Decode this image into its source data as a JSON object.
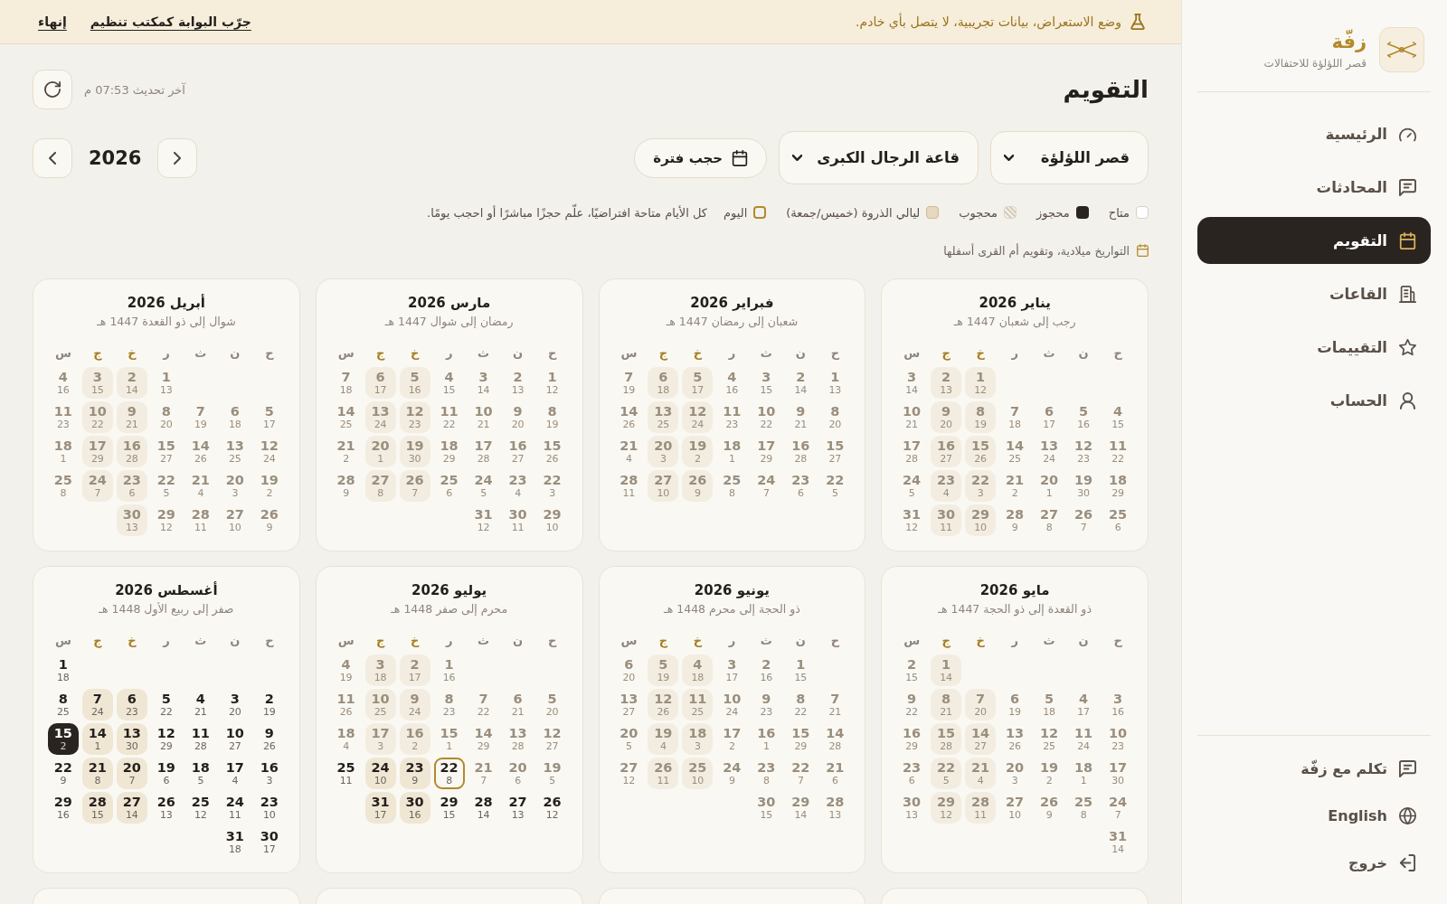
{
  "banner": {
    "message": "وضع الاستعراض، بيانات تجريبية، لا يتصل بأي خادم.",
    "links": [
      "جرّب البوابة كمكتب تنظيم",
      "إنهاء"
    ]
  },
  "header": {
    "title": "التقويم",
    "last_updated": "آخر تحديث 07:53 م"
  },
  "filters": [
    {
      "value": "قصر اللؤلؤة"
    },
    {
      "value": "قاعة الرجال الكبرى"
    }
  ],
  "block_button": "حجب فترة",
  "year": "2026",
  "legend": [
    {
      "kind": "available",
      "label": "متاح"
    },
    {
      "kind": "booked",
      "label": "محجوز"
    },
    {
      "kind": "blocked",
      "label": "محجوب"
    },
    {
      "kind": "peak",
      "label": "ليالي الذروة (خميس/جمعة)"
    },
    {
      "kind": "today",
      "label": "اليوم"
    }
  ],
  "legend_note": "كل الأيام متاحة افتراضيًا، علّم حجزًا مباشرًا أو احجب يومًا.",
  "calendar_note": "التواريخ ميلادية، وتقويم أم القرى أسفلها",
  "months": [
    {
      "title": "يناير 2026",
      "hijri_range": "رجب إلى شعبان 1447 هـ",
      "weekdays": [
        {
          "label": "ح",
          "peak": false
        },
        {
          "label": "ن",
          "peak": false
        },
        {
          "label": "ث",
          "peak": false
        },
        {
          "label": "ر",
          "peak": false
        },
        {
          "label": "خ",
          "peak": true
        },
        {
          "label": "ج",
          "peak": true
        },
        {
          "label": "س",
          "peak": false
        }
      ],
      "weeks": [
        [
          {
            "day": "1",
            "hijri": "12",
            "kind": "past"
          },
          {
            "day": "2",
            "hijri": "13",
            "kind": "past"
          },
          {
            "day": "3",
            "hijri": "14",
            "kind": "past"
          }
        ],
        [
          {
            "day": "4",
            "hijri": "15",
            "kind": "past"
          },
          {
            "day": "5",
            "hijri": "16",
            "kind": "past"
          },
          {
            "day": "6",
            "hijri": "17",
            "kind": "past"
          },
          {
            "day": "7",
            "hijri": "18",
            "kind": "past"
          },
          {
            "day": "8",
            "hijri": "19",
            "kind": "past"
          },
          {
            "day": "9",
            "hijri": "20",
            "kind": "past"
          },
          {
            "day": "10",
            "hijri": "21",
            "kind": "past"
          }
        ],
        [
          {
            "day": "11",
            "hijri": "22",
            "kind": "past"
          },
          {
            "day": "12",
            "hijri": "23",
            "kind": "past"
          },
          {
            "day": "13",
            "hijri": "24",
            "kind": "past"
          },
          {
            "day": "14",
            "hijri": "25",
            "kind": "past"
          },
          {
            "day": "15",
            "hijri": "26",
            "kind": "past"
          },
          {
            "day": "16",
            "hijri": "27",
            "kind": "past"
          },
          {
            "day": "17",
            "hijri": "28",
            "kind": "past"
          }
        ],
        [
          {
            "day": "18",
            "hijri": "29",
            "kind": "past"
          },
          {
            "day": "19",
            "hijri": "30",
            "kind": "past"
          },
          {
            "day": "20",
            "hijri": "1",
            "kind": "past"
          },
          {
            "day": "21",
            "hijri": "2",
            "kind": "past"
          },
          {
            "day": "22",
            "hijri": "3",
            "kind": "past"
          },
          {
            "day": "23",
            "hijri": "4",
            "kind": "past"
          },
          {
            "day": "24",
            "hijri": "5",
            "kind": "past"
          }
        ],
        [
          {
            "day": "25",
            "hijri": "6",
            "kind": "past"
          },
          {
            "day": "26",
            "hijri": "7",
            "kind": "past"
          },
          {
            "day": "27",
            "hijri": "8",
            "kind": "past"
          },
          {
            "day": "28",
            "hijri": "9",
            "kind": "past"
          },
          {
            "day": "29",
            "hijri": "10",
            "kind": "past"
          },
          {
            "day": "30",
            "hijri": "11",
            "kind": "past"
          },
          {
            "day": "31",
            "hijri": "12",
            "kind": "past"
          }
        ]
      ]
    },
    {
      "title": "فبراير 2026",
      "hijri_range": "شعبان إلى رمضان 1447 هـ",
      "weekdays": [
        {
          "label": "ح",
          "peak": false
        },
        {
          "label": "ن",
          "peak": false
        },
        {
          "label": "ث",
          "peak": false
        },
        {
          "label": "ر",
          "peak": false
        },
        {
          "label": "خ",
          "peak": true
        },
        {
          "label": "ج",
          "peak": true
        },
        {
          "label": "س",
          "peak": false
        }
      ],
      "weeks": [
        [
          {
            "day": "1",
            "hijri": "13",
            "kind": "past"
          },
          {
            "day": "2",
            "hijri": "14",
            "kind": "past"
          },
          {
            "day": "3",
            "hijri": "15",
            "kind": "past"
          },
          {
            "day": "4",
            "hijri": "16",
            "kind": "past"
          },
          {
            "day": "5",
            "hijri": "17",
            "kind": "past"
          },
          {
            "day": "6",
            "hijri": "18",
            "kind": "past"
          },
          {
            "day": "7",
            "hijri": "19",
            "kind": "past"
          }
        ],
        [
          {
            "day": "8",
            "hijri": "20",
            "kind": "past"
          },
          {
            "day": "9",
            "hijri": "21",
            "kind": "past"
          },
          {
            "day": "10",
            "hijri": "22",
            "kind": "past"
          },
          {
            "day": "11",
            "hijri": "23",
            "kind": "past"
          },
          {
            "day": "12",
            "hijri": "24",
            "kind": "past"
          },
          {
            "day": "13",
            "hijri": "25",
            "kind": "past"
          },
          {
            "day": "14",
            "hijri": "26",
            "kind": "past"
          }
        ],
        [
          {
            "day": "15",
            "hijri": "27",
            "kind": "past"
          },
          {
            "day": "16",
            "hijri": "28",
            "kind": "past"
          },
          {
            "day": "17",
            "hijri": "29",
            "kind": "past"
          },
          {
            "day": "18",
            "hijri": "1",
            "kind": "past"
          },
          {
            "day": "19",
            "hijri": "2",
            "kind": "past"
          },
          {
            "day": "20",
            "hijri": "3",
            "kind": "past"
          },
          {
            "day": "21",
            "hijri": "4",
            "kind": "past"
          }
        ],
        [
          {
            "day": "22",
            "hijri": "5",
            "kind": "past"
          },
          {
            "day": "23",
            "hijri": "6",
            "kind": "past"
          },
          {
            "day": "24",
            "hijri": "7",
            "kind": "past"
          },
          {
            "day": "25",
            "hijri": "8",
            "kind": "past"
          },
          {
            "day": "26",
            "hijri": "9",
            "kind": "past"
          },
          {
            "day": "27",
            "hijri": "10",
            "kind": "past"
          },
          {
            "day": "28",
            "hijri": "11",
            "kind": "past"
          }
        ]
      ]
    },
    {
      "title": "مارس 2026",
      "hijri_range": "رمضان إلى شوال 1447 هـ",
      "weekdays": [
        {
          "label": "ح",
          "peak": false
        },
        {
          "label": "ن",
          "peak": false
        },
        {
          "label": "ث",
          "peak": false
        },
        {
          "label": "ر",
          "peak": false
        },
        {
          "label": "خ",
          "peak": true
        },
        {
          "label": "ج",
          "peak": true
        },
        {
          "label": "س",
          "peak": false
        }
      ],
      "weeks": [
        [
          {
            "day": "1",
            "hijri": "12",
            "kind": "past"
          },
          {
            "day": "2",
            "hijri": "13",
            "kind": "past"
          },
          {
            "day": "3",
            "hijri": "14",
            "kind": "past"
          },
          {
            "day": "4",
            "hijri": "15",
            "kind": "past"
          },
          {
            "day": "5",
            "hijri": "16",
            "kind": "past"
          },
          {
            "day": "6",
            "hijri": "17",
            "kind": "past"
          },
          {
            "day": "7",
            "hijri": "18",
            "kind": "past"
          }
        ],
        [
          {
            "day": "8",
            "hijri": "19",
            "kind": "past"
          },
          {
            "day": "9",
            "hijri": "20",
            "kind": "past"
          },
          {
            "day": "10",
            "hijri": "21",
            "kind": "past"
          },
          {
            "day": "11",
            "hijri": "22",
            "kind": "past"
          },
          {
            "day": "12",
            "hijri": "23",
            "kind": "past"
          },
          {
            "day": "13",
            "hijri": "24",
            "kind": "past"
          },
          {
            "day": "14",
            "hijri": "25",
            "kind": "past"
          }
        ],
        [
          {
            "day": "15",
            "hijri": "26",
            "kind": "past"
          },
          {
            "day": "16",
            "hijri": "27",
            "kind": "past"
          },
          {
            "day": "17",
            "hijri": "28",
            "kind": "past"
          },
          {
            "day": "18",
            "hijri": "29",
            "kind": "past"
          },
          {
            "day": "19",
            "hijri": "30",
            "kind": "past"
          },
          {
            "day": "20",
            "hijri": "1",
            "kind": "past"
          },
          {
            "day": "21",
            "hijri": "2",
            "kind": "past"
          }
        ],
        [
          {
            "day": "22",
            "hijri": "3",
            "kind": "past"
          },
          {
            "day": "23",
            "hijri": "4",
            "kind": "past"
          },
          {
            "day": "24",
            "hijri": "5",
            "kind": "past"
          },
          {
            "day": "25",
            "hijri": "6",
            "kind": "past"
          },
          {
            "day": "26",
            "hijri": "7",
            "kind": "past"
          },
          {
            "day": "27",
            "hijri": "8",
            "kind": "past"
          },
          {
            "day": "28",
            "hijri": "9",
            "kind": "past"
          }
        ],
        [
          {
            "day": "29",
            "hijri": "10",
            "kind": "past"
          },
          {
            "day": "30",
            "hijri": "11",
            "kind": "past"
          },
          {
            "day": "31",
            "hijri": "12",
            "kind": "past"
          }
        ]
      ]
    },
    {
      "title": "أبريل 2026",
      "hijri_range": "شوال إلى ذو القعدة 1447 هـ",
      "weekdays": [
        {
          "label": "ح",
          "peak": false
        },
        {
          "label": "ن",
          "peak": false
        },
        {
          "label": "ث",
          "peak": false
        },
        {
          "label": "ر",
          "peak": false
        },
        {
          "label": "خ",
          "peak": true
        },
        {
          "label": "ج",
          "peak": true
        },
        {
          "label": "س",
          "peak": false
        }
      ],
      "weeks": [
        [
          {
            "day": "1",
            "hijri": "13",
            "kind": "past"
          },
          {
            "day": "2",
            "hijri": "14",
            "kind": "past"
          },
          {
            "day": "3",
            "hijri": "15",
            "kind": "past"
          },
          {
            "day": "4",
            "hijri": "16",
            "kind": "past"
          }
        ],
        [
          {
            "day": "5",
            "hijri": "17",
            "kind": "past"
          },
          {
            "day": "6",
            "hijri": "18",
            "kind": "past"
          },
          {
            "day": "7",
            "hijri": "19",
            "kind": "past"
          },
          {
            "day": "8",
            "hijri": "20",
            "kind": "past"
          },
          {
            "day": "9",
            "hijri": "21",
            "kind": "past"
          },
          {
            "day": "10",
            "hijri": "22",
            "kind": "past"
          },
          {
            "day": "11",
            "hijri": "23",
            "kind": "past"
          }
        ],
        [
          {
            "day": "12",
            "hijri": "24",
            "kind": "past"
          },
          {
            "day": "13",
            "hijri": "25",
            "kind": "past"
          },
          {
            "day": "14",
            "hijri": "26",
            "kind": "past"
          },
          {
            "day": "15",
            "hijri": "27",
            "kind": "past"
          },
          {
            "day": "16",
            "hijri": "28",
            "kind": "past"
          },
          {
            "day": "17",
            "hijri": "29",
            "kind": "past"
          },
          {
            "day": "18",
            "hijri": "1",
            "kind": "past"
          }
        ],
        [
          {
            "day": "19",
            "hijri": "2",
            "kind": "past"
          },
          {
            "day": "20",
            "hijri": "3",
            "kind": "past"
          },
          {
            "day": "21",
            "hijri": "4",
            "kind": "past"
          },
          {
            "day": "22",
            "hijri": "5",
            "kind": "past"
          },
          {
            "day": "23",
            "hijri": "6",
            "kind": "past"
          },
          {
            "day": "24",
            "hijri": "7",
            "kind": "past"
          },
          {
            "day": "25",
            "hijri": "8",
            "kind": "past"
          }
        ],
        [
          {
            "day": "26",
            "hijri": "9",
            "kind": "past"
          },
          {
            "day": "27",
            "hijri": "10",
            "kind": "past"
          },
          {
            "day": "28",
            "hijri": "11",
            "kind": "past"
          },
          {
            "day": "29",
            "hijri": "12",
            "kind": "past"
          },
          {
            "day": "30",
            "hijri": "13",
            "kind": "past"
          }
        ]
      ]
    },
    {
      "title": "مايو 2026",
      "hijri_range": "ذو القعدة إلى ذو الحجة 1447 هـ",
      "weekdays": [
        {
          "label": "ح",
          "peak": false
        },
        {
          "label": "ن",
          "peak": false
        },
        {
          "label": "ث",
          "peak": false
        },
        {
          "label": "ر",
          "peak": false
        },
        {
          "label": "خ",
          "peak": true
        },
        {
          "label": "ج",
          "peak": true
        },
        {
          "label": "س",
          "peak": false
        }
      ],
      "weeks": [
        [
          {
            "day": "1",
            "hijri": "14",
            "kind": "past"
          },
          {
            "day": "2",
            "hijri": "15",
            "kind": "past"
          }
        ],
        [
          {
            "day": "3",
            "hijri": "16",
            "kind": "past"
          },
          {
            "day": "4",
            "hijri": "17",
            "kind": "past"
          },
          {
            "day": "5",
            "hijri": "18",
            "kind": "past"
          },
          {
            "day": "6",
            "hijri": "19",
            "kind": "past"
          },
          {
            "day": "7",
            "hijri": "20",
            "kind": "past"
          },
          {
            "day": "8",
            "hijri": "21",
            "kind": "past"
          },
          {
            "day": "9",
            "hijri": "22",
            "kind": "past"
          }
        ],
        [
          {
            "day": "10",
            "hijri": "23",
            "kind": "past"
          },
          {
            "day": "11",
            "hijri": "24",
            "kind": "past"
          },
          {
            "day": "12",
            "hijri": "25",
            "kind": "past"
          },
          {
            "day": "13",
            "hijri": "26",
            "kind": "past"
          },
          {
            "day": "14",
            "hijri": "27",
            "kind": "past"
          },
          {
            "day": "15",
            "hijri": "28",
            "kind": "past"
          },
          {
            "day": "16",
            "hijri": "29",
            "kind": "past"
          }
        ],
        [
          {
            "day": "17",
            "hijri": "30",
            "kind": "past"
          },
          {
            "day": "18",
            "hijri": "1",
            "kind": "past"
          },
          {
            "day": "19",
            "hijri": "2",
            "kind": "past"
          },
          {
            "day": "20",
            "hijri": "3",
            "kind": "past"
          },
          {
            "day": "21",
            "hijri": "4",
            "kind": "past"
          },
          {
            "day": "22",
            "hijri": "5",
            "kind": "past"
          },
          {
            "day": "23",
            "hijri": "6",
            "kind": "past"
          }
        ],
        [
          {
            "day": "24",
            "hijri": "7",
            "kind": "past"
          },
          {
            "day": "25",
            "hijri": "8",
            "kind": "past"
          },
          {
            "day": "26",
            "hijri": "9",
            "kind": "past"
          },
          {
            "day": "27",
            "hijri": "10",
            "kind": "past"
          },
          {
            "day": "28",
            "hijri": "11",
            "kind": "past"
          },
          {
            "day": "29",
            "hijri": "12",
            "kind": "past"
          },
          {
            "day": "30",
            "hijri": "13",
            "kind": "past"
          }
        ],
        [
          {
            "day": "31",
            "hijri": "14",
            "kind": "past"
          }
        ]
      ]
    },
    {
      "title": "يونيو 2026",
      "hijri_range": "ذو الحجة إلى محرم 1448 هـ",
      "weekdays": [
        {
          "label": "ح",
          "peak": false
        },
        {
          "label": "ن",
          "peak": false
        },
        {
          "label": "ث",
          "peak": false
        },
        {
          "label": "ر",
          "peak": false
        },
        {
          "label": "خ",
          "peak": true
        },
        {
          "label": "ج",
          "peak": true
        },
        {
          "label": "س",
          "peak": false
        }
      ],
      "weeks": [
        [
          {
            "day": "1",
            "hijri": "15",
            "kind": "past"
          },
          {
            "day": "2",
            "hijri": "16",
            "kind": "past"
          },
          {
            "day": "3",
            "hijri": "17",
            "kind": "past"
          },
          {
            "day": "4",
            "hijri": "18",
            "kind": "past"
          },
          {
            "day": "5",
            "hijri": "19",
            "kind": "past"
          },
          {
            "day": "6",
            "hijri": "20",
            "kind": "past"
          }
        ],
        [
          {
            "day": "7",
            "hijri": "21",
            "kind": "past"
          },
          {
            "day": "8",
            "hijri": "22",
            "kind": "past"
          },
          {
            "day": "9",
            "hijri": "23",
            "kind": "past"
          },
          {
            "day": "10",
            "hijri": "24",
            "kind": "past"
          },
          {
            "day": "11",
            "hijri": "25",
            "kind": "past"
          },
          {
            "day": "12",
            "hijri": "26",
            "kind": "past"
          },
          {
            "day": "13",
            "hijri": "27",
            "kind": "past"
          }
        ],
        [
          {
            "day": "14",
            "hijri": "28",
            "kind": "past"
          },
          {
            "day": "15",
            "hijri": "29",
            "kind": "past"
          },
          {
            "day": "16",
            "hijri": "1",
            "kind": "past"
          },
          {
            "day": "17",
            "hijri": "2",
            "kind": "past"
          },
          {
            "day": "18",
            "hijri": "3",
            "kind": "past"
          },
          {
            "day": "19",
            "hijri": "4",
            "kind": "past"
          },
          {
            "day": "20",
            "hijri": "5",
            "kind": "past"
          }
        ],
        [
          {
            "day": "21",
            "hijri": "6",
            "kind": "past"
          },
          {
            "day": "22",
            "hijri": "7",
            "kind": "past"
          },
          {
            "day": "23",
            "hijri": "8",
            "kind": "past"
          },
          {
            "day": "24",
            "hijri": "9",
            "kind": "past"
          },
          {
            "day": "25",
            "hijri": "10",
            "kind": "past"
          },
          {
            "day": "26",
            "hijri": "11",
            "kind": "past"
          },
          {
            "day": "27",
            "hijri": "12",
            "kind": "past"
          }
        ],
        [
          {
            "day": "28",
            "hijri": "13",
            "kind": "past"
          },
          {
            "day": "29",
            "hijri": "14",
            "kind": "past"
          },
          {
            "day": "30",
            "hijri": "15",
            "kind": "past"
          }
        ]
      ]
    },
    {
      "title": "يوليو 2026",
      "hijri_range": "محرم إلى صفر 1448 هـ",
      "weekdays": [
        {
          "label": "ح",
          "peak": false
        },
        {
          "label": "ن",
          "peak": false
        },
        {
          "label": "ث",
          "peak": false
        },
        {
          "label": "ر",
          "peak": false
        },
        {
          "label": "خ",
          "peak": true
        },
        {
          "label": "ج",
          "peak": true
        },
        {
          "label": "س",
          "peak": false
        }
      ],
      "weeks": [
        [
          {
            "day": "1",
            "hijri": "16",
            "kind": "past"
          },
          {
            "day": "2",
            "hijri": "17",
            "kind": "past"
          },
          {
            "day": "3",
            "hijri": "18",
            "kind": "past"
          },
          {
            "day": "4",
            "hijri": "19",
            "kind": "past"
          }
        ],
        [
          {
            "day": "5",
            "hijri": "20",
            "kind": "past"
          },
          {
            "day": "6",
            "hijri": "21",
            "kind": "past"
          },
          {
            "day": "7",
            "hijri": "22",
            "kind": "past"
          },
          {
            "day": "8",
            "hijri": "23",
            "kind": "past"
          },
          {
            "day": "9",
            "hijri": "24",
            "kind": "past"
          },
          {
            "day": "10",
            "hijri": "25",
            "kind": "past"
          },
          {
            "day": "11",
            "hijri": "26",
            "kind": "past"
          }
        ],
        [
          {
            "day": "12",
            "hijri": "27",
            "kind": "past"
          },
          {
            "day": "13",
            "hijri": "28",
            "kind": "past"
          },
          {
            "day": "14",
            "hijri": "29",
            "kind": "past"
          },
          {
            "day": "15",
            "hijri": "1",
            "kind": "past"
          },
          {
            "day": "16",
            "hijri": "2",
            "kind": "past"
          },
          {
            "day": "17",
            "hijri": "3",
            "kind": "past"
          },
          {
            "day": "18",
            "hijri": "4",
            "kind": "past"
          }
        ],
        [
          {
            "day": "19",
            "hijri": "5",
            "kind": "past"
          },
          {
            "day": "20",
            "hijri": "6",
            "kind": "past"
          },
          {
            "day": "21",
            "hijri": "7",
            "kind": "past"
          },
          {
            "day": "22",
            "hijri": "8",
            "kind": "today"
          },
          {
            "day": "23",
            "hijri": "9",
            "kind": "available"
          },
          {
            "day": "24",
            "hijri": "10",
            "kind": "available"
          },
          {
            "day": "25",
            "hijri": "11",
            "kind": "available"
          }
        ],
        [
          {
            "day": "26",
            "hijri": "12",
            "kind": "available"
          },
          {
            "day": "27",
            "hijri": "13",
            "kind": "available"
          },
          {
            "day": "28",
            "hijri": "14",
            "kind": "available"
          },
          {
            "day": "29",
            "hijri": "15",
            "kind": "available"
          },
          {
            "day": "30",
            "hijri": "16",
            "kind": "available"
          },
          {
            "day": "31",
            "hijri": "17",
            "kind": "available"
          }
        ]
      ]
    },
    {
      "title": "أغسطس 2026",
      "hijri_range": "صفر إلى ربيع الأول 1448 هـ",
      "weekdays": [
        {
          "label": "ح",
          "peak": false
        },
        {
          "label": "ن",
          "peak": false
        },
        {
          "label": "ث",
          "peak": false
        },
        {
          "label": "ر",
          "peak": false
        },
        {
          "label": "خ",
          "peak": true
        },
        {
          "label": "ج",
          "peak": true
        },
        {
          "label": "س",
          "peak": false
        }
      ],
      "weeks": [
        [
          {
            "day": "1",
            "hijri": "18",
            "kind": "available"
          }
        ],
        [
          {
            "day": "2",
            "hijri": "19",
            "kind": "available"
          },
          {
            "day": "3",
            "hijri": "20",
            "kind": "available"
          },
          {
            "day": "4",
            "hijri": "21",
            "kind": "available"
          },
          {
            "day": "5",
            "hijri": "22",
            "kind": "available"
          },
          {
            "day": "6",
            "hijri": "23",
            "kind": "available"
          },
          {
            "day": "7",
            "hijri": "24",
            "kind": "available"
          },
          {
            "day": "8",
            "hijri": "25",
            "kind": "available"
          }
        ],
        [
          {
            "day": "9",
            "hijri": "26",
            "kind": "available"
          },
          {
            "day": "10",
            "hijri": "27",
            "kind": "available"
          },
          {
            "day": "11",
            "hijri": "28",
            "kind": "available"
          },
          {
            "day": "12",
            "hijri": "29",
            "kind": "available"
          },
          {
            "day": "13",
            "hijri": "30",
            "kind": "available"
          },
          {
            "day": "14",
            "hijri": "1",
            "kind": "available"
          },
          {
            "day": "15",
            "hijri": "2",
            "kind": "booked"
          }
        ],
        [
          {
            "day": "16",
            "hijri": "3",
            "kind": "available"
          },
          {
            "day": "17",
            "hijri": "4",
            "kind": "available"
          },
          {
            "day": "18",
            "hijri": "5",
            "kind": "available"
          },
          {
            "day": "19",
            "hijri": "6",
            "kind": "available"
          },
          {
            "day": "20",
            "hijri": "7",
            "kind": "available"
          },
          {
            "day": "21",
            "hijri": "8",
            "kind": "available"
          },
          {
            "day": "22",
            "hijri": "9",
            "kind": "available"
          }
        ],
        [
          {
            "day": "23",
            "hijri": "10",
            "kind": "available"
          },
          {
            "day": "24",
            "hijri": "11",
            "kind": "available"
          },
          {
            "day": "25",
            "hijri": "12",
            "kind": "available"
          },
          {
            "day": "26",
            "hijri": "13",
            "kind": "available"
          },
          {
            "day": "27",
            "hijri": "14",
            "kind": "available"
          },
          {
            "day": "28",
            "hijri": "15",
            "kind": "available"
          },
          {
            "day": "29",
            "hijri": "16",
            "kind": "available"
          }
        ],
        [
          {
            "day": "30",
            "hijri": "17",
            "kind": "available"
          },
          {
            "day": "31",
            "hijri": "18",
            "kind": "available"
          }
        ]
      ]
    }
  ],
  "more_rows_below": true,
  "sidebar": {
    "brand": "زفّة",
    "venue": "قصر اللؤلؤة للاحتفالات",
    "nav": [
      {
        "label": "الرئيسية",
        "selected": false
      },
      {
        "label": "المحادثات",
        "selected": false
      },
      {
        "label": "التقويم",
        "selected": true
      },
      {
        "label": "القاعات",
        "selected": false
      },
      {
        "label": "التقييمات",
        "selected": false
      },
      {
        "label": "الحساب",
        "selected": false
      }
    ],
    "footer": [
      "تكلم مع زفّة",
      "English",
      "خروج"
    ]
  }
}
